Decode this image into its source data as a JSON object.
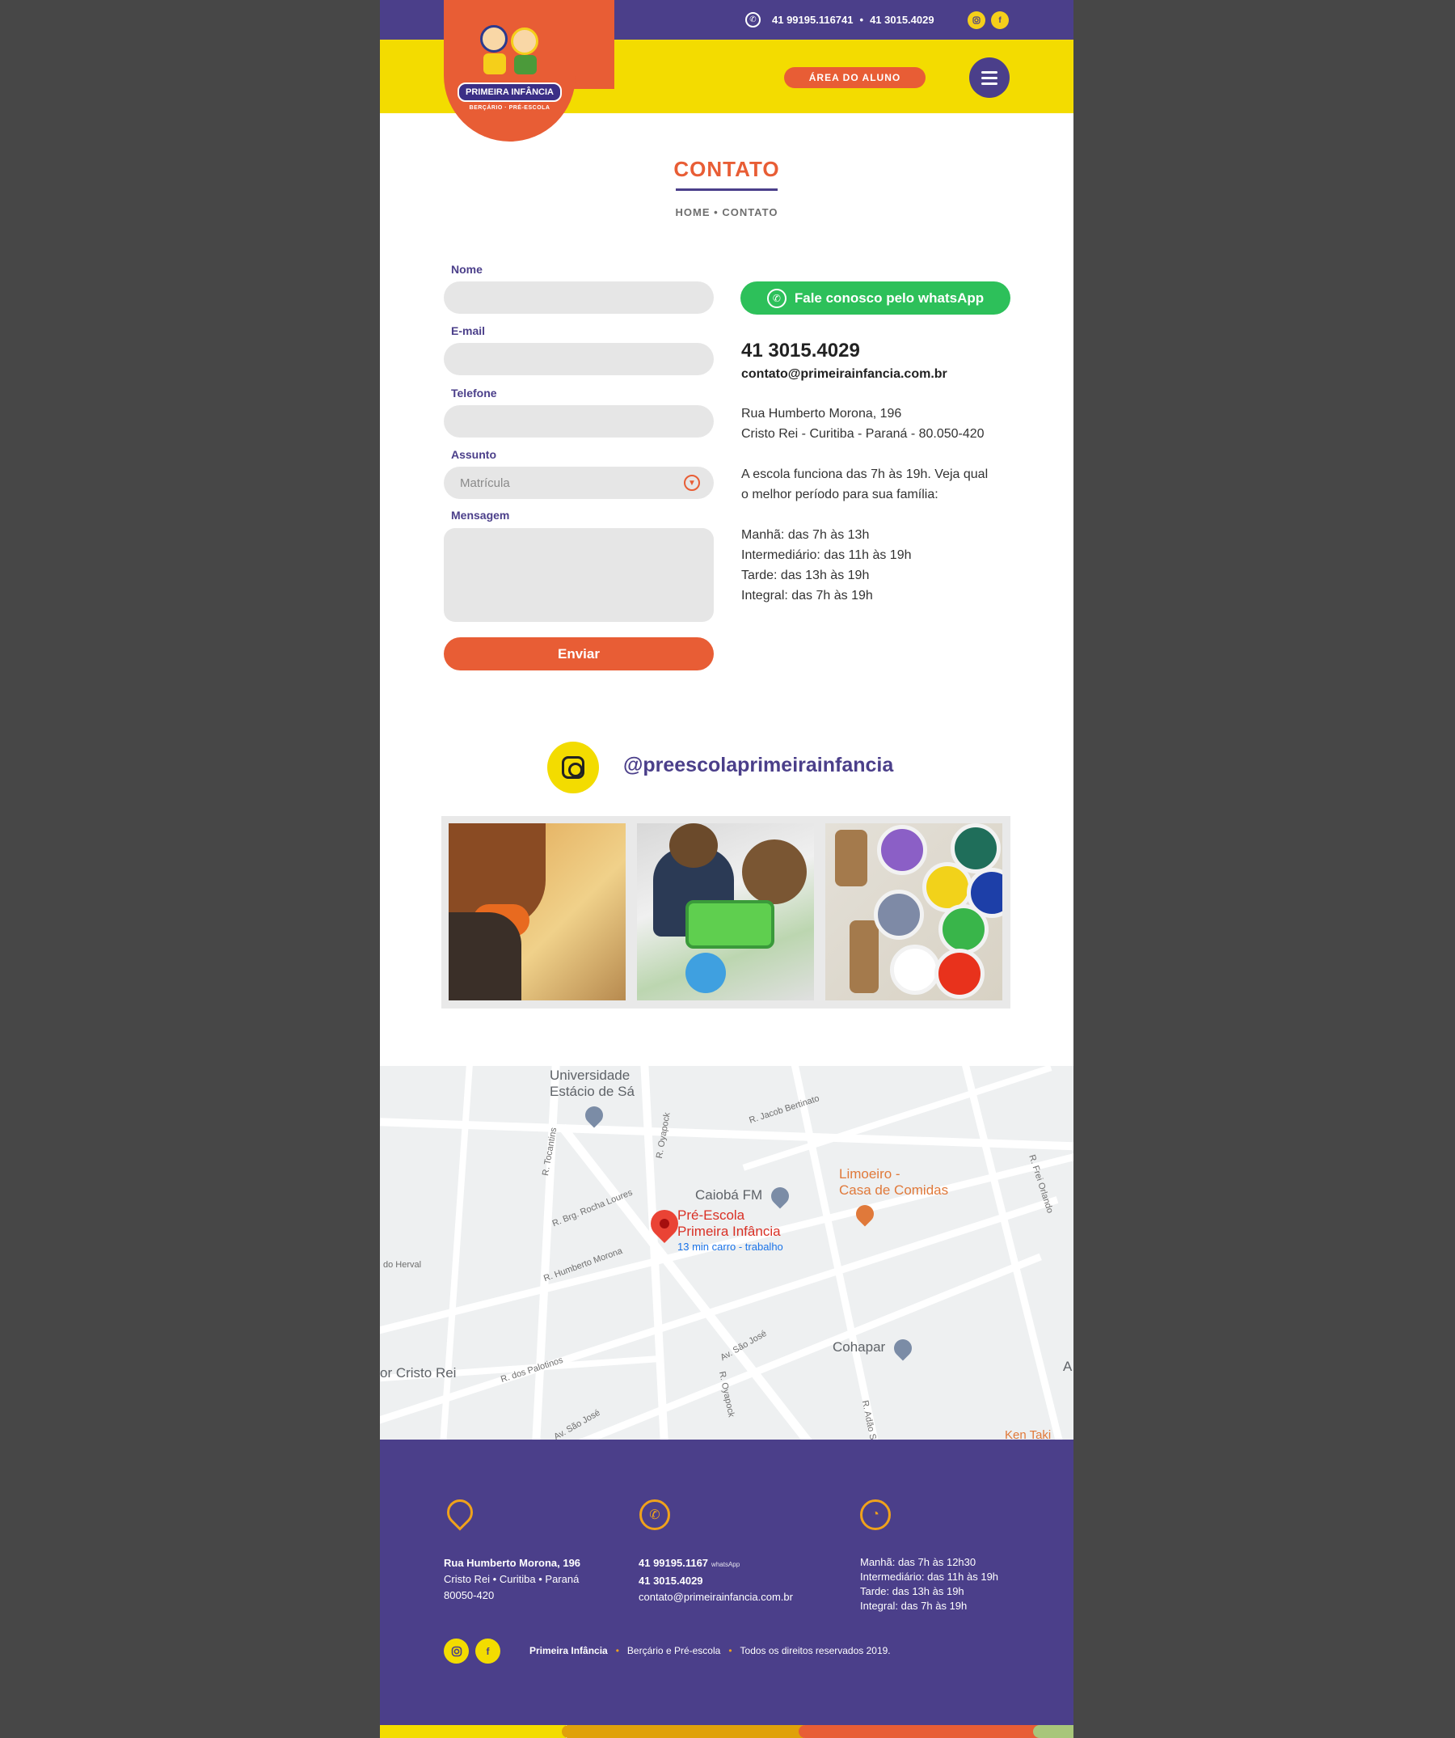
{
  "topbar": {
    "phone1": "41 99195.116741",
    "separator": "•",
    "phone2": "41 3015.4029",
    "social": {
      "instagram": "instagram-icon",
      "facebook": "f"
    }
  },
  "header": {
    "logo_brand": "PRIMEIRA INFÂNCIA",
    "logo_sub": "BERÇÁRIO · PRÉ-ESCOLA",
    "area_aluno": "ÁREA DO ALUNO"
  },
  "page": {
    "title": "CONTATO",
    "breadcrumb": "HOME • CONTATO"
  },
  "form": {
    "nome_label": "Nome",
    "email_label": "E-mail",
    "telefone_label": "Telefone",
    "assunto_label": "Assunto",
    "assunto_value": "Matrícula",
    "mensagem_label": "Mensagem",
    "submit": "Enviar"
  },
  "contact": {
    "whatsapp_button": "Fale conosco pelo whatsApp",
    "phone": "41 3015.4029",
    "email": "contato@primeirainfancia.com.br",
    "address1": "Rua Humberto Morona, 196",
    "address2": "Cristo Rei - Curitiba - Paraná - 80.050-420",
    "hours_intro1": "A escola funciona das 7h às 19h. Veja qual",
    "hours_intro2": "o melhor período para sua família:",
    "h1": "Manhã: das 7h às 13h",
    "h2": "Intermediário: das 11h às 19h",
    "h3": "Tarde: das 13h às 19h",
    "h4": "Integral: das 7h às 19h"
  },
  "instagram": {
    "handle": "@preescolaprimeirainfancia"
  },
  "map": {
    "univ1": "Universidade",
    "univ2": "Estácio de Sá",
    "caioba": "Caiobá FM",
    "limoeiro1": "Limoeiro -",
    "limoeiro2": "Casa de Comidas",
    "school1": "Pré-Escola",
    "school2": "Primeira Infância",
    "route": "13 min carro - trabalho",
    "cohapar": "Cohapar",
    "cristo_rei": "or Cristo Rei",
    "do_herval": "do Herval",
    "kentaki": "Ken Taki",
    "a_letter": "A",
    "streets": {
      "tocantins": "R. Tocantins",
      "oyapock1": "R. Oyapock",
      "jacob": "R. Jacob Bertinato",
      "frei": "R. Frei Orlando",
      "rocha": "R. Brg. Rocha Loures",
      "humberto": "R. Humberto Morona",
      "palotinos": "R. dos Palotinos",
      "saojose1": "Av. São José",
      "saojose2": "Av. São José",
      "oyapock2": "R. Oyapock",
      "adao": "R. Adão S"
    }
  },
  "footer": {
    "address_bold": "Rua Humberto Morona, 196",
    "address_line2": "Cristo Rei  •  Curitiba  •  Paraná",
    "address_line3": "80050-420",
    "phone1": "41 99195.1167",
    "phone1_tag": "whatsApp",
    "phone2": "41 3015.4029",
    "email": "contato@primeirainfancia.com.br",
    "h1": "Manhã: das 7h às 12h30",
    "h2": "Intermediário: das 11h às 19h",
    "h3": "Tarde: das 13h às 19h",
    "h4": "Integral: das 7h às 19h",
    "brand": "Primeira Infância",
    "tagline": "Berçário e Pré-escola",
    "rights": "Todos os direitos reservados 2019.",
    "dot": "•",
    "facebook": "f"
  },
  "colors": {
    "purple": "#4b3f8a",
    "yellow": "#f3dc00",
    "orange": "#e85d35",
    "green": "#2dc05a"
  }
}
